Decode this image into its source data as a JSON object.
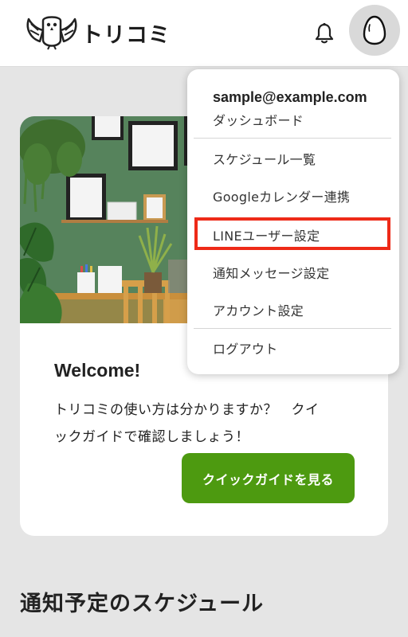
{
  "header": {
    "logo_text": "トリコミ"
  },
  "dropdown": {
    "email": "sample@example.com",
    "items": [
      "ダッシュボード",
      "スケジュール一覧",
      "Googleカレンダー連携",
      "LINEユーザー設定",
      "通知メッセージ設定",
      "アカウント設定",
      "ログアウト"
    ],
    "highlighted_index": 3,
    "highlight_color": "#ee2a18"
  },
  "welcome_card": {
    "title": "Welcome!",
    "description_line1": "トリコミの使い方は分かりますか？　クイ",
    "description_line2": "ックガイドで確認しましょう！",
    "button_label": "クイックガイドを見る",
    "button_color": "#4d9a10"
  },
  "schedule_section": {
    "title": "通知予定のスケジュール"
  }
}
